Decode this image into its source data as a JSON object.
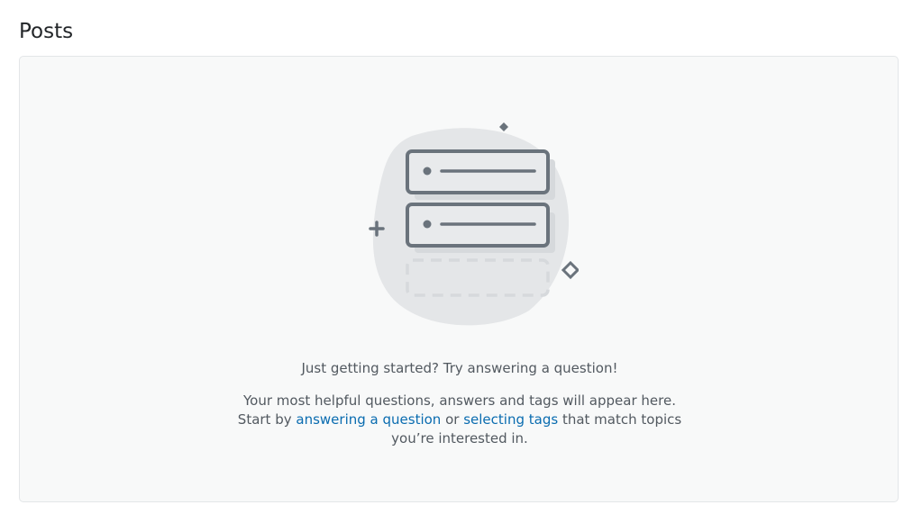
{
  "page": {
    "title": "Posts"
  },
  "empty_state": {
    "headline": "Just getting started? Try answering a question!",
    "text_before": "Your most helpful questions, answers and tags will appear here. Start by",
    "link_answering": "answering a question",
    "text_or": "or",
    "link_tags": "selecting tags",
    "text_after": "that match topics you’re interested in.",
    "illustration_icon": "stacked-posts-icon"
  },
  "colors": {
    "link": "#0a6cb0",
    "text": "#525960",
    "panel_bg": "#f8f9f9",
    "panel_border": "#e3e6e8",
    "icon_stroke": "#6a737c"
  }
}
